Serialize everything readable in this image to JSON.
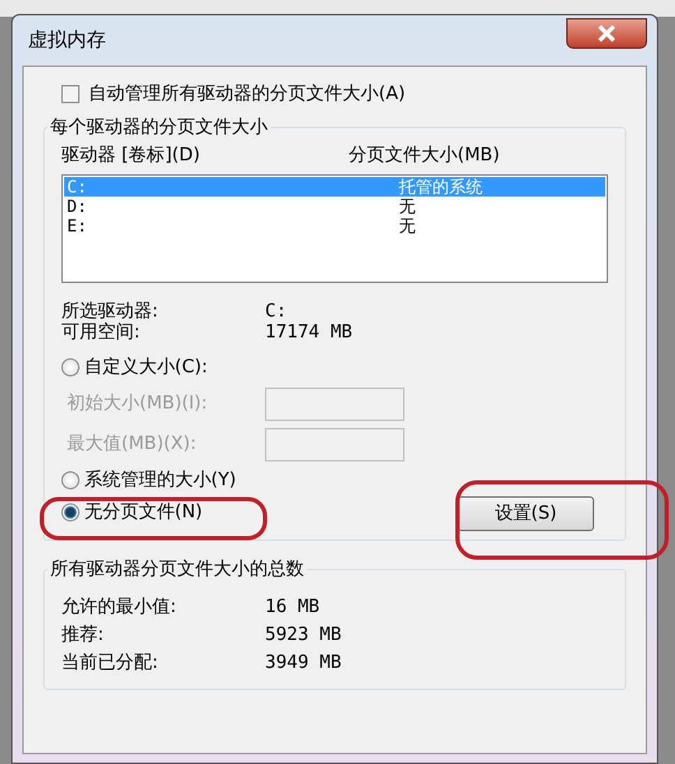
{
  "window": {
    "title": "虚拟内存"
  },
  "auto_manage": {
    "label": "自动管理所有驱动器的分页文件大小(A)",
    "checked": false
  },
  "per_drive": {
    "title": "每个驱动器的分页文件大小",
    "columns": [
      "驱动器 [卷标](D)",
      "分页文件大小(MB)"
    ],
    "rows": [
      {
        "drive": "C:",
        "size": "托管的系统",
        "selected": true
      },
      {
        "drive": "D:",
        "size": "无",
        "selected": false
      },
      {
        "drive": "E:",
        "size": "无",
        "selected": false
      }
    ],
    "info": [
      {
        "label": "所选驱动器:",
        "value": "C:"
      },
      {
        "label": "可用空间:",
        "value": "17174 MB"
      }
    ],
    "options": [
      {
        "kind": "radio",
        "label": "自定义大小(C):",
        "selected": false
      },
      {
        "kind": "field",
        "label": "初始大小(MB)(I):",
        "disabled": true
      },
      {
        "kind": "field",
        "label": "最大值(MB)(X):",
        "disabled": true
      },
      {
        "kind": "radio",
        "label": "系统管理的大小(Y)",
        "selected": false
      },
      {
        "kind": "radio",
        "label": "无分页文件(N)",
        "selected": true
      }
    ],
    "set_button": "设置(S)"
  },
  "totals": {
    "title": "所有驱动器分页文件大小的总数",
    "rows": [
      {
        "label": "允许的最小值:",
        "value": "16 MB"
      },
      {
        "label": "推荐:",
        "value": "5923 MB"
      },
      {
        "label": "当前已分配:",
        "value": "3949 MB"
      }
    ]
  }
}
